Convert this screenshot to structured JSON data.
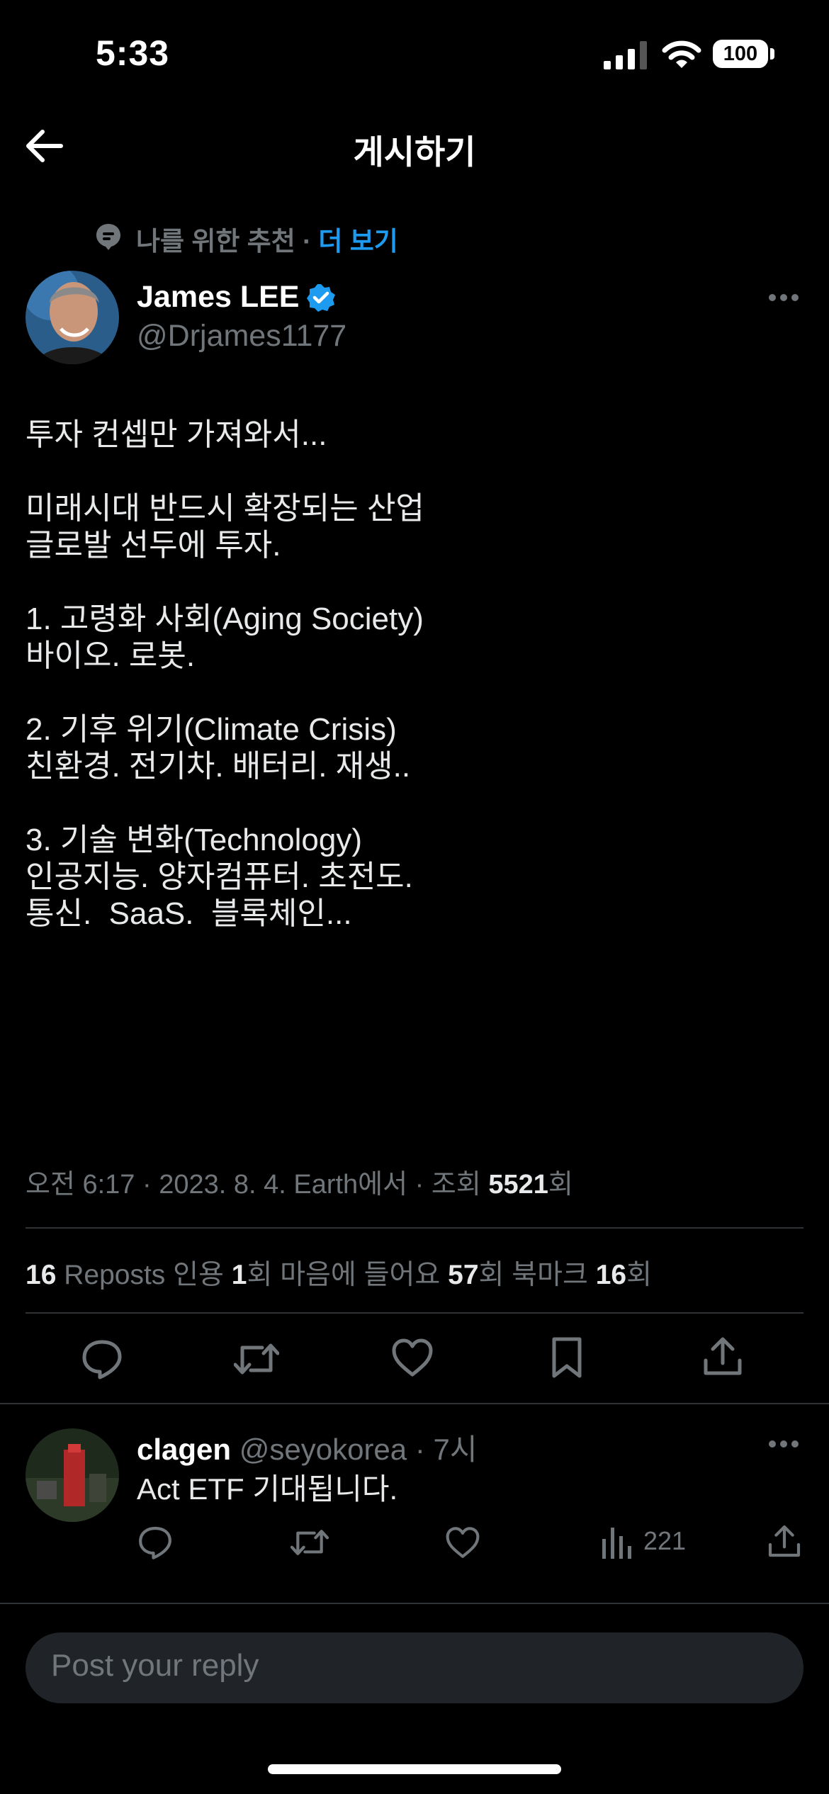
{
  "status_bar": {
    "time": "5:33",
    "battery": "100"
  },
  "header": {
    "title": "게시하기"
  },
  "recommendation": {
    "label": "나를 위한 추천 ·",
    "more": "더 보기"
  },
  "tweet": {
    "author_name": "James LEE",
    "author_handle": "@Drjames1177",
    "lines": [
      "투자 컨셉만 가져와서...",
      "",
      "미래시대 반드시 확장되는 산업",
      "글로발 선두에 투자.",
      "",
      "1. 고령화 사회(Aging Society)",
      "바이오. 로봇.",
      "",
      "2. 기후 위기(Climate Crisis)",
      "친환경. 전기차. 배터리. 재생..",
      "",
      "3. 기술 변화(Technology)",
      "인공지능. 양자컴퓨터. 초전도.",
      "통신.  SaaS.  블록체인..."
    ],
    "meta_prefix": "오전 6:17 · 2023. 8. 4. Earth에서 · 조회 ",
    "views": "5521",
    "views_suffix": "회"
  },
  "stats": {
    "reposts_count": "16",
    "reposts_label": " Reposts  ",
    "quotes_label": "인용 ",
    "quotes_count": "1",
    "quotes_suffix": "회  ",
    "likes_label": "마음에 들어요 ",
    "likes_count": "57",
    "likes_suffix": "회  ",
    "bookmarks_label": "북마크 ",
    "bookmarks_count": "16",
    "bookmarks_suffix": "회"
  },
  "reply": {
    "name": "clagen",
    "handle": " @seyokorea",
    "time": " · 7시",
    "text": "Act ETF 기대됩니다.",
    "views": "221"
  },
  "composer": {
    "placeholder": "Post your reply"
  },
  "colors": {
    "accent": "#1d9bf0",
    "muted": "#71767b",
    "background": "#000000",
    "divider": "#2f3336"
  }
}
